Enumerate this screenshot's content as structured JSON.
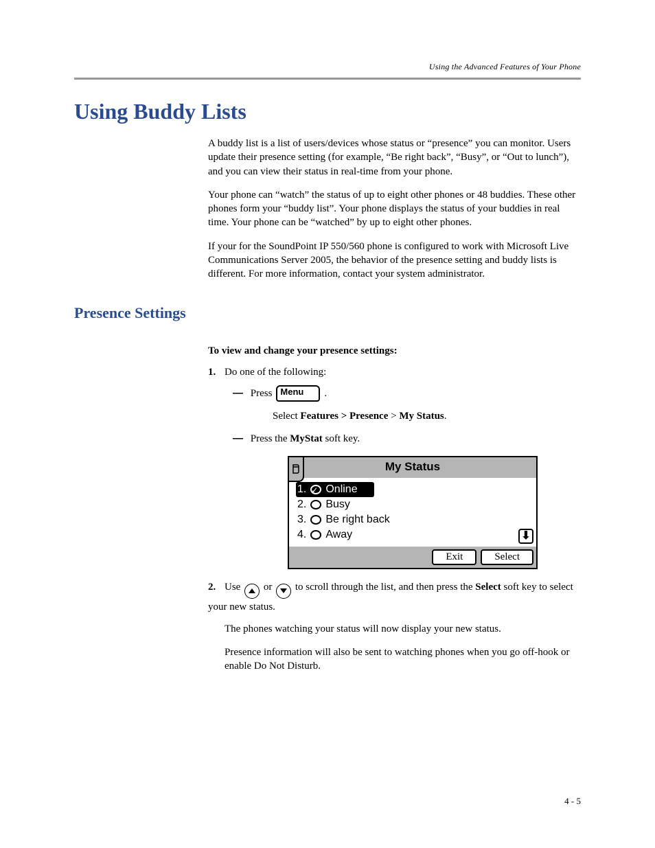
{
  "runningHead": "Using the Advanced Features of Your Phone",
  "h1": "Using Buddy Lists",
  "intro": {
    "p1": "A buddy list is a list of users/devices whose status or “presence” you can monitor. Users update their presence setting (for example, “Be right back”, “Busy”, or “Out to lunch”), and you can view their status in real-time from your phone.",
    "p2": "Your phone can “watch” the status of up to eight other phones or 48 buddies. These other phones form your “buddy list”. Your phone displays the status of your buddies in real time. Your phone can be “watched” by up to eight other phones.",
    "p3": "If your for the SoundPoint IP 550/560 phone is configured to work with Microsoft Live Communications Server 2005, the behavior of the presence setting and buddy lists is different. For more information, contact your system administrator."
  },
  "h2": "Presence Settings",
  "h3": "To view and change your presence settings:",
  "step1": {
    "marker": "1.",
    "text": "Do one of the following:",
    "optA_press": "Press",
    "optA_menuLabel": "Menu",
    "optA_period": ".",
    "optA_select_prefix": "Select ",
    "optA_select_bold": "Features > Presence",
    "optA_select_mid": " > ",
    "optA_select_bold2": "My Status",
    "optA_select_suffix": ".",
    "optB_prefix": "Press the ",
    "optB_bold": "MyStat",
    "optB_suffix": " soft key."
  },
  "screen": {
    "title": "My Status",
    "items": [
      {
        "n": "1.",
        "label": "Online",
        "selected": true
      },
      {
        "n": "2.",
        "label": "Busy",
        "selected": false
      },
      {
        "n": "3.",
        "label": "Be right back",
        "selected": false
      },
      {
        "n": "4.",
        "label": "Away",
        "selected": false
      }
    ],
    "softkeys": {
      "exit": "Exit",
      "select": "Select"
    }
  },
  "step2": {
    "marker": "2.",
    "t1": "Use ",
    "t2": " or ",
    "t3": " to scroll through the list, and then press the ",
    "t3_bold": "Select",
    "t4": " soft key to select your new status.",
    "p2": "The phones watching your status will now display your new status.",
    "p3": "Presence information will also be sent to watching phones when you go off-hook or enable Do Not Disturb."
  },
  "pageNum": "4 - 5"
}
